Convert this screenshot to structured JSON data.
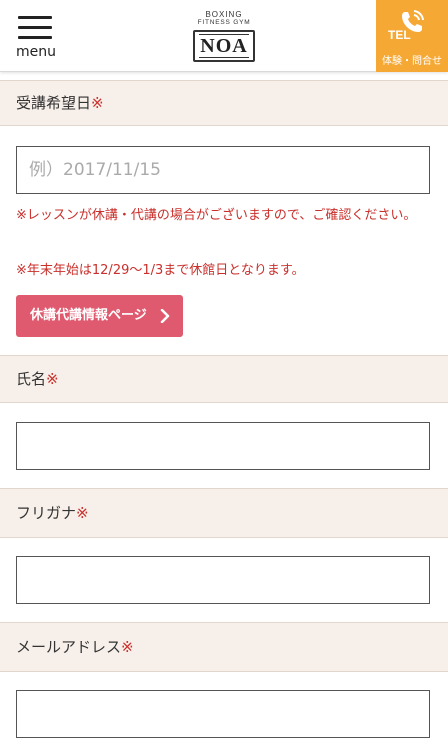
{
  "header": {
    "menu_label": "menu",
    "logo": {
      "line1": "BOXING",
      "line2": "FITNESS GYM",
      "name": "NOA"
    },
    "tel": {
      "label": "TEL",
      "sub": "体験・問合せ",
      "color": "#f5a833"
    }
  },
  "form": {
    "date": {
      "label": "受講希望日",
      "required_mark": "※",
      "placeholder": "例）2017/11/15",
      "value": ""
    },
    "notes": [
      "※レッスンが休講・代講の場合がございますので、ご確認ください。",
      "※年末年始は12/29〜1/3まで休館日となります。"
    ],
    "info_button": {
      "label": "休講代講情報ページ",
      "icon": "chevron-right-icon",
      "color": "#e05a6f"
    },
    "name": {
      "label": "氏名",
      "required_mark": "※",
      "value": ""
    },
    "furigana": {
      "label": "フリガナ",
      "required_mark": "※",
      "value": ""
    },
    "email": {
      "label": "メールアドレス",
      "required_mark": "※",
      "value": ""
    }
  },
  "colors": {
    "required": "#c9302c",
    "section_bg": "#f7efe9"
  }
}
